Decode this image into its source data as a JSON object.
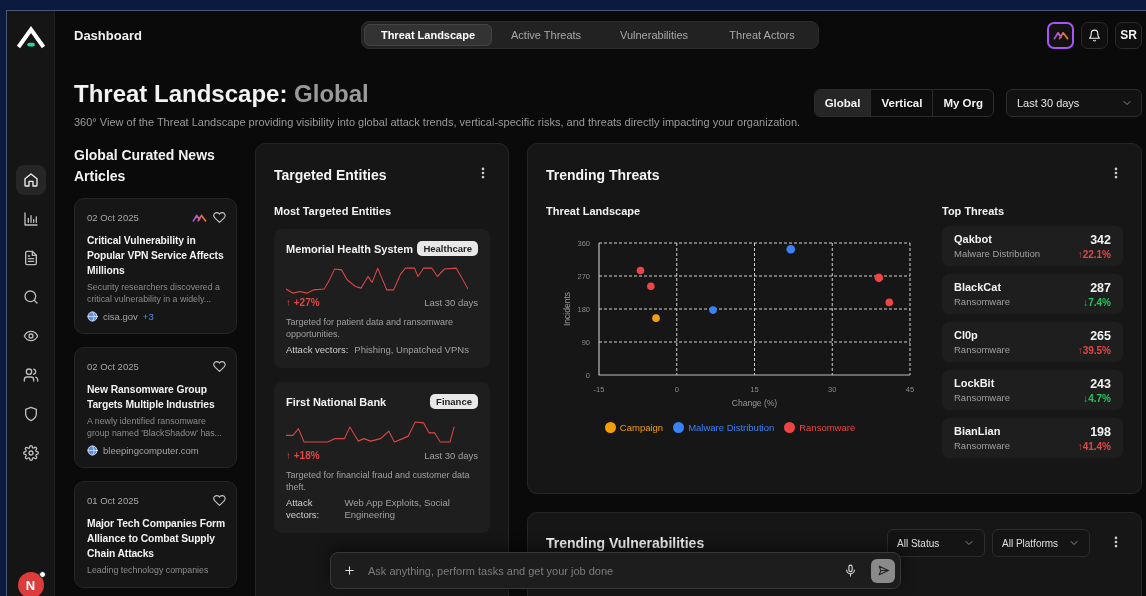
{
  "sidebar": {
    "items": [
      {
        "selected": true
      },
      {
        "selected": false
      },
      {
        "selected": false
      },
      {
        "selected": false
      },
      {
        "selected": false
      },
      {
        "selected": false
      },
      {
        "selected": false
      },
      {
        "selected": false
      }
    ],
    "user": {
      "initial": "N",
      "notification": true
    }
  },
  "header": {
    "title": "Dashboard",
    "tabs": [
      {
        "label": "Threat Landscape",
        "selected": true
      },
      {
        "label": "Active Threats",
        "selected": false
      },
      {
        "label": "Vulnerabilities",
        "selected": false
      },
      {
        "label": "Threat Actors",
        "selected": false
      }
    ],
    "user_initials": "SR"
  },
  "page": {
    "title": "Threat Landscape:",
    "scope": "Global",
    "subtitle": "360° View of the Threat Landscape providing visibility into global attack trends, vertical-specific risks, and threats directly impacting your organization.",
    "scope_options": [
      {
        "label": "Global",
        "selected": true
      },
      {
        "label": "Vertical",
        "selected": false
      },
      {
        "label": "My Org",
        "selected": false
      }
    ],
    "period": "Last 30 days"
  },
  "news": {
    "title": "Global Curated News Articles",
    "articles": [
      {
        "date": "02 Oct 2025",
        "ai_tagged": true,
        "title": "Critical Vulnerability in Popular VPN Service Affects Millions",
        "summary": "Security researchers discovered a critical vulnerability in a widely...",
        "source": "cisa.gov",
        "more_sources": "+3"
      },
      {
        "date": "02 Oct 2025",
        "ai_tagged": false,
        "title": "New Ransomware Group Targets Multiple Industries",
        "summary": "A newly identified ransomware group named 'BlackShadow' has...",
        "source": "bleepingcomputer.com"
      },
      {
        "date": "01 Oct 2025",
        "ai_tagged": false,
        "title": "Major Tech Companies Form Alliance to Combat Supply Chain Attacks",
        "summary": "Leading technology companies"
      }
    ]
  },
  "targeted_entities": {
    "title": "Targeted Entities",
    "subtitle": "Most Targeted Entities",
    "entities": [
      {
        "name": "Memorial Health System",
        "sector": "Healthcare",
        "change": "↑ +27%",
        "color": "#e04848",
        "period": "Last 30 days",
        "description": "Targeted for patient data and ransomware opportunities.",
        "vectors_label": "Attack vectors:",
        "vectors": "Phishing, Unpatched VPNs"
      },
      {
        "name": "First National Bank",
        "sector": "Finance",
        "change": "↑ +18%",
        "color": "#e04848",
        "period": "Last 30 days",
        "description": "Targeted for financial fraud and customer data theft.",
        "vectors_label": "Attack vectors:",
        "vectors": "Web App Exploits, Social Engineering"
      }
    ]
  },
  "trending_threats": {
    "title": "Trending Threats",
    "chart": {
      "title": "Threat Landscape",
      "chart_data": {
        "type": "scatter",
        "xlabel": "Change (%)",
        "ylabel": "Incidents",
        "x": [
          -7,
          -5,
          -4,
          7,
          22,
          39,
          41
        ],
        "xlim": [
          -15,
          45
        ],
        "ylim": [
          0,
          360
        ],
        "xticks": [
          -15,
          0,
          15,
          30,
          45
        ],
        "grid": true,
        "yticks": [
          0,
          90,
          180,
          270,
          360
        ],
        "series": [
          {
            "name": "Campaign",
            "color": "#f59e0b",
            "values": [
              null,
              null,
              155,
              null,
              null,
              null,
              null
            ]
          },
          {
            "name": "Malware Distribution",
            "color": "#3b82f6",
            "values": [
              null,
              null,
              null,
              177,
              343,
              null,
              null
            ]
          },
          {
            "name": "Ransomware",
            "color": "#ef4444",
            "values": [
              285,
              242,
              null,
              null,
              null,
              265,
              198
            ]
          }
        ]
      }
    },
    "top_threats": {
      "title": "Top Threats",
      "items": [
        {
          "name": "Qakbot",
          "category": "Malware Distribution",
          "count": "342",
          "change": "↑22.1%",
          "color": "#e04848"
        },
        {
          "name": "BlackCat",
          "category": "Ransomware",
          "count": "287",
          "change": "↓7.4%",
          "color": "#22c55e"
        },
        {
          "name": "Cl0p",
          "category": "Ransomware",
          "count": "265",
          "change": "↑39.5%",
          "color": "#e04848"
        },
        {
          "name": "LockBit",
          "category": "Ransomware",
          "count": "243",
          "change": "↓4.7%",
          "color": "#22c55e"
        },
        {
          "name": "BianLian",
          "category": "Ransomware",
          "count": "198",
          "change": "↑41.4%",
          "color": "#e04848"
        }
      ]
    }
  },
  "trending_vulnerabilities": {
    "title": "Trending Vulnerabilities",
    "filters": [
      "All Status",
      "All Platforms"
    ]
  },
  "assistant": {
    "placeholder": "Ask anything, perform tasks and get your job done"
  }
}
